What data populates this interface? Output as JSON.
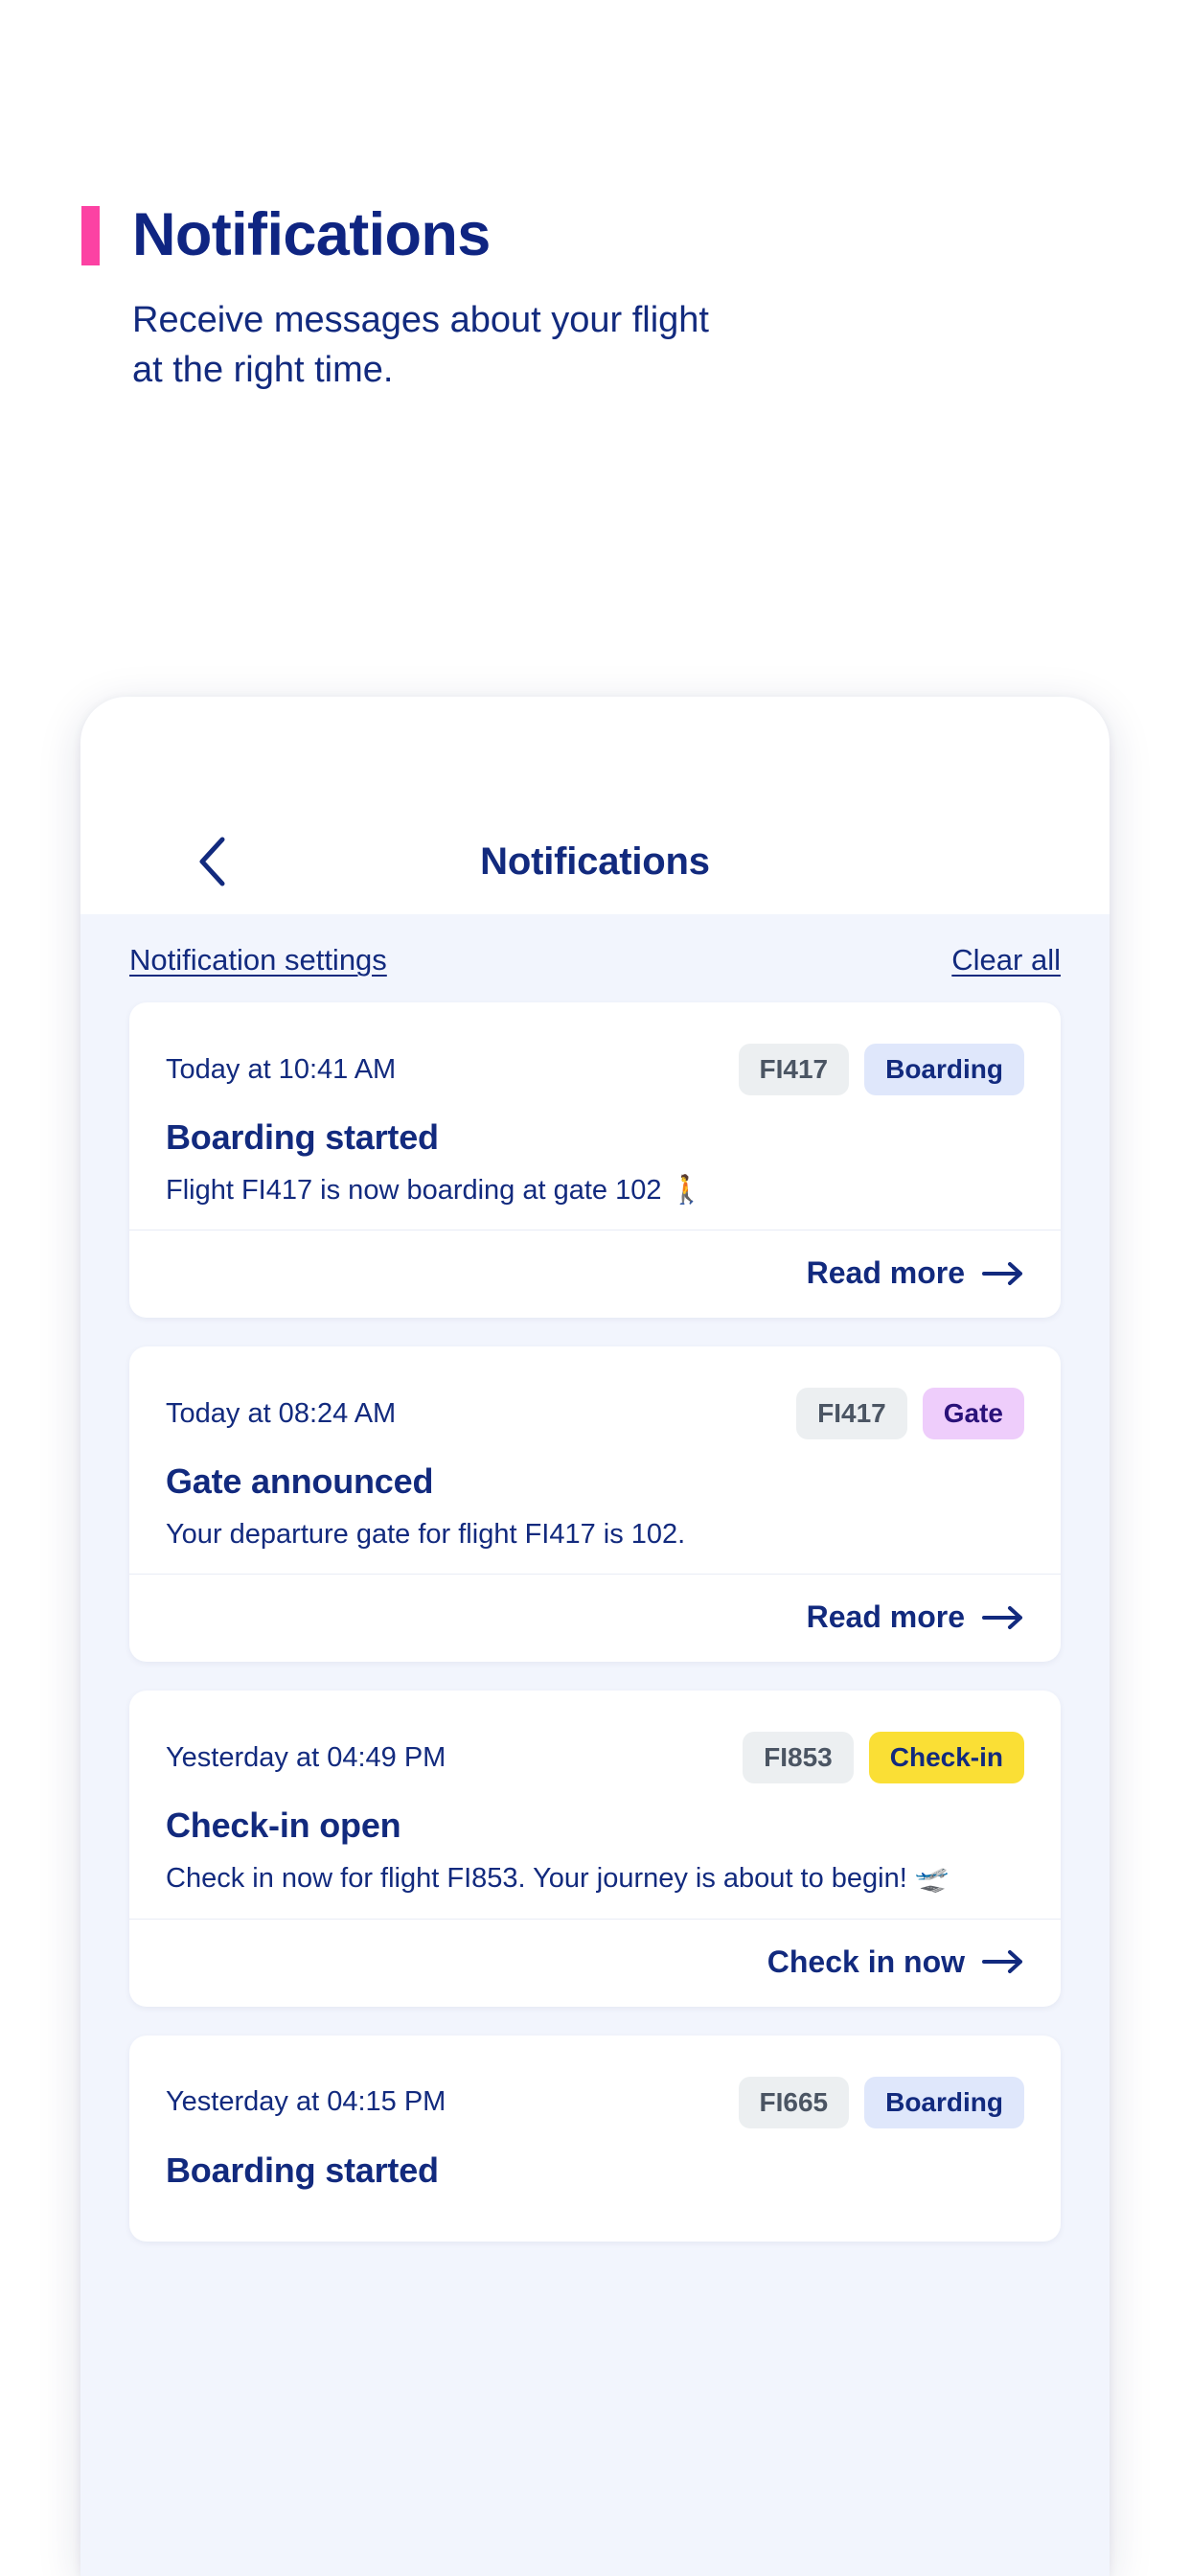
{
  "intro": {
    "title": "Notifications",
    "subtitle": "Receive messages about your flight at the right time.",
    "accent_color": "#fc42a3",
    "text_color": "#122a7e"
  },
  "phone": {
    "header": {
      "back_icon": "chevron-left-icon",
      "title": "Notifications"
    },
    "actions": {
      "settings_label": "Notification settings",
      "clear_label": "Clear all"
    },
    "cards": [
      {
        "time": "Today at 10:41 AM",
        "flight_badge": "FI417",
        "status_badge": "Boarding",
        "status_type": "boarding",
        "heading": "Boarding started",
        "text": "Flight FI417 is now boarding at gate 102 🚶",
        "cta": "Read more",
        "cta_icon": "arrow-right-icon"
      },
      {
        "time": "Today at 08:24 AM",
        "flight_badge": "FI417",
        "status_badge": "Gate",
        "status_type": "gate",
        "heading": "Gate announced",
        "text": "Your departure gate for flight FI417 is 102.",
        "cta": "Read more",
        "cta_icon": "arrow-right-icon"
      },
      {
        "time": "Yesterday at 04:49 PM",
        "flight_badge": "FI853",
        "status_badge": "Check-in",
        "status_type": "checkin",
        "heading": "Check-in open",
        "text": "Check in now for flight FI853. Your journey is about to begin! 🛫",
        "cta": "Check in now",
        "cta_icon": "arrow-right-icon"
      },
      {
        "time": "Yesterday at 04:15 PM",
        "flight_badge": "FI665",
        "status_badge": "Boarding",
        "status_type": "boarding",
        "heading": "Boarding started",
        "text": "",
        "cta": "",
        "cta_icon": "arrow-right-icon"
      }
    ]
  },
  "colors": {
    "brand_blue": "#122a7e",
    "pink_accent": "#fc42a3",
    "badge_gray_bg": "#eceff1",
    "badge_boarding_bg": "#dfe7fb",
    "badge_gate_bg": "#eecdfb",
    "badge_checkin_bg": "#fadf35",
    "phone_bg": "#f2f5fd"
  }
}
